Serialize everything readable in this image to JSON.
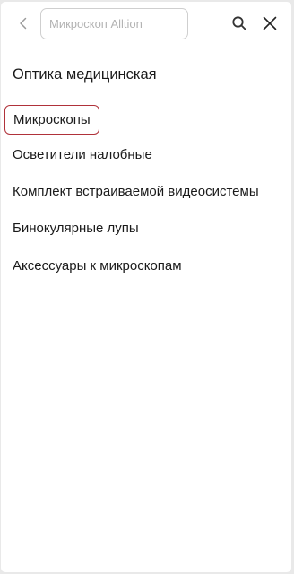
{
  "header": {
    "back_icon": "chevron-left-icon",
    "search": {
      "value": "",
      "placeholder": "Микроскоп Alltion"
    },
    "search_icon": "search-icon",
    "close_icon": "close-icon"
  },
  "section": {
    "title": "Оптика медицинская"
  },
  "menu": {
    "items": [
      {
        "label": "Микроскопы",
        "selected": true
      },
      {
        "label": "Осветители налобные",
        "selected": false
      },
      {
        "label": "Комплект встраиваемой видеосистемы",
        "selected": false
      },
      {
        "label": "Бинокулярные лупы",
        "selected": false
      },
      {
        "label": "Аксессуары к микроскопам",
        "selected": false
      }
    ]
  },
  "colors": {
    "background": "#ffffff",
    "text": "#1a1a1a",
    "selected_border": "#b0323a",
    "placeholder": "#b3b3b3"
  }
}
